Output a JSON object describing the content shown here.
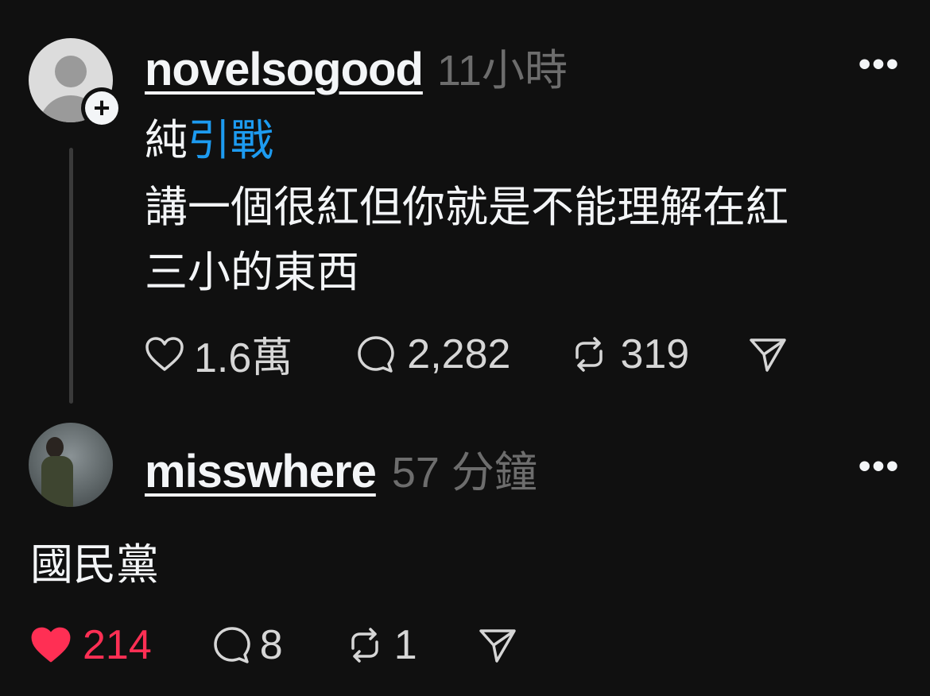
{
  "post": {
    "username": "novelsogood",
    "time": "11小時",
    "text_prefix": "純",
    "text_link": "引戰",
    "text_body_line1": "講一個很紅但你就是不能理解在紅",
    "text_body_line2": "三小的東西",
    "likes": "1.6萬",
    "comments": "2,282",
    "reposts": "319",
    "more_label": "•••"
  },
  "reply": {
    "username": "misswhere",
    "time": "57 分鐘",
    "text": "國民黨",
    "likes": "214",
    "comments": "8",
    "reposts": "1",
    "more_label": "•••"
  },
  "colors": {
    "background": "#101010",
    "link": "#1d9bf0",
    "liked": "#ff2f54",
    "muted": "#6d6d6d"
  },
  "icons": {
    "like": "heart-icon",
    "comment": "comment-bubble-icon",
    "repost": "repost-icon",
    "share": "send-icon",
    "more": "more-horizontal-icon"
  }
}
